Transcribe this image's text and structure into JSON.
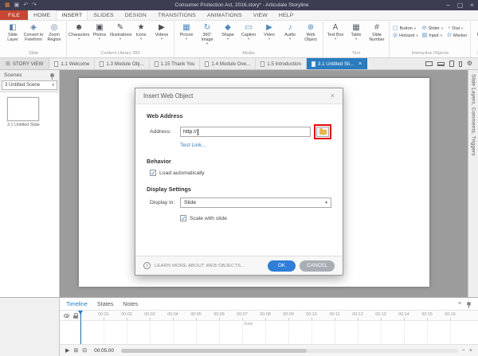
{
  "titlebar": {
    "title": "Consumer Protection Act, 2016.story* - Articulate Storyline"
  },
  "icons": {
    "app_logo": "▦",
    "save": "▣",
    "undo": "↶",
    "redo": "↷",
    "minimize": "–",
    "maximize": "▢",
    "close": "×",
    "story_view_grid": "⊞",
    "gear": "⚙",
    "select_caret": "▾",
    "tab_close": "×",
    "dialog_close": "×",
    "check": "✓",
    "info": "i",
    "timeline_menu": "≡"
  },
  "menubar": {
    "items": [
      {
        "label": "FILE",
        "file": true
      },
      {
        "label": "HOME"
      },
      {
        "label": "INSERT",
        "active": true
      },
      {
        "label": "SLIDES"
      },
      {
        "label": "DESIGN"
      },
      {
        "label": "TRANSITIONS"
      },
      {
        "label": "ANIMATIONS"
      },
      {
        "label": "VIEW"
      },
      {
        "label": "HELP"
      }
    ]
  },
  "ribbon": {
    "groups": [
      {
        "label": "Slide",
        "items": [
          {
            "label": "Slide Layer",
            "glyph": "◧",
            "color": "#5b7fa6",
            "caret": false
          },
          {
            "label": "Convert to Freeform",
            "glyph": "◈",
            "color": "#5b7fa6",
            "caret": false
          },
          {
            "label": "Zoom Region",
            "glyph": "◎",
            "color": "#5b7fa6",
            "caret": false
          }
        ]
      },
      {
        "label": "Content Library 360",
        "items": [
          {
            "label": "Characters",
            "glyph": "☻",
            "color": "#4a4a55",
            "caret": true
          },
          {
            "label": "Photos",
            "glyph": "▣",
            "color": "#4a4a55",
            "caret": true
          },
          {
            "label": "Illustrations",
            "glyph": "✎",
            "color": "#4a4a55",
            "caret": true
          },
          {
            "label": "Icons",
            "glyph": "★",
            "color": "#4a4a55",
            "caret": true
          },
          {
            "label": "Videos",
            "glyph": "▶",
            "color": "#4a4a55",
            "caret": true
          }
        ]
      },
      {
        "label": "Media",
        "items": [
          {
            "label": "Picture",
            "glyph": "▦",
            "color": "#4e8ac0",
            "caret": true
          },
          {
            "label": "360° Image",
            "glyph": "↻",
            "color": "#4e8ac0",
            "caret": true
          },
          {
            "label": "Shape",
            "glyph": "◆",
            "color": "#4e8ac0",
            "caret": true
          },
          {
            "label": "Caption",
            "glyph": "▭",
            "color": "#4e8ac0",
            "caret": true
          },
          {
            "label": "Video",
            "glyph": "▶",
            "color": "#4e8ac0",
            "caret": true
          },
          {
            "label": "Audio",
            "glyph": "♪",
            "color": "#4e8ac0",
            "caret": true
          },
          {
            "label": "Web Object",
            "glyph": "⊕",
            "color": "#4e8ac0",
            "caret": false
          }
        ]
      },
      {
        "label": "Text",
        "items": [
          {
            "label": "Text Box",
            "glyph": "A",
            "color": "#55606a",
            "caret": true
          },
          {
            "label": "Table",
            "glyph": "▦",
            "color": "#55606a",
            "caret": true
          },
          {
            "label": "Slide Number",
            "glyph": "#",
            "color": "#55606a",
            "caret": false
          }
        ]
      },
      {
        "label": "Interactive Objects",
        "small": true,
        "items": [
          {
            "label": "Button",
            "glyph": "▢",
            "color": "#4e8ac0",
            "caret": true
          },
          {
            "label": "Slider",
            "glyph": "⊖",
            "color": "#4e8ac0",
            "caret": true
          },
          {
            "label": "Dial",
            "glyph": "◔",
            "color": "#4e8ac0",
            "caret": true
          },
          {
            "label": "Hotspot",
            "glyph": "◎",
            "color": "#4e8ac0",
            "caret": true
          },
          {
            "label": "Input",
            "glyph": "▤",
            "color": "#4e8ac0",
            "caret": true
          },
          {
            "label": "Marker",
            "glyph": "⊙",
            "color": "#4e8ac0",
            "caret": false
          }
        ]
      },
      {
        "label": "Publish",
        "publish": true,
        "items": [
          {
            "label": "Preview",
            "glyph": "▶",
            "color": "#3c3c46",
            "caret": true
          }
        ]
      }
    ]
  },
  "tabstrip": {
    "story_view": "STORY VIEW",
    "tabs": [
      {
        "label": "1.1 Welcome"
      },
      {
        "label": "1.3 Module Obj..."
      },
      {
        "label": "1.15 Thank You"
      },
      {
        "label": "1.4 Module Ove..."
      },
      {
        "label": "1.5 Introduction"
      },
      {
        "label": "3.1 Untitled Sli...",
        "active": true
      }
    ]
  },
  "scenes": {
    "title": "Scenes",
    "dropdown": "3 Untitled Scene",
    "thumbnail_label": "3.1 Untitled Slide"
  },
  "side_panels": {
    "label": "Slide Layers, Comments, Triggers"
  },
  "dialog": {
    "title": "Insert Web Object",
    "web_address_section": "Web Address",
    "address_label": "Address:",
    "address_value": "http://",
    "test_link": "Test Link...",
    "behavior_section": "Behavior",
    "load_automatically": "Load automatically",
    "display_settings_section": "Display Settings",
    "display_in_label": "Display in:",
    "display_in_value": "Slide",
    "scale_with_slide": "Scale with slide",
    "learn_more": "LEARN MORE ABOUT WEB OBJECTS...",
    "ok": "OK",
    "cancel": "CANCEL"
  },
  "timeline": {
    "tabs": [
      {
        "label": "Timeline",
        "active": true
      },
      {
        "label": "States"
      },
      {
        "label": "Notes"
      }
    ],
    "ticks": [
      "00:01",
      "00:02",
      "00:03",
      "00:04",
      "00:05",
      "00:06",
      "00:07",
      "00:08",
      "00:09",
      "00:10",
      "00:11",
      "00:12",
      "00:13",
      "00:14",
      "00:15",
      "00:16"
    ],
    "end_label": "End",
    "time_display": "00:05.00",
    "controls": {
      "play": "▶",
      "icon1": "⊞",
      "icon2": "⊟",
      "zoom_out": "−",
      "zoom_in": "+"
    }
  }
}
